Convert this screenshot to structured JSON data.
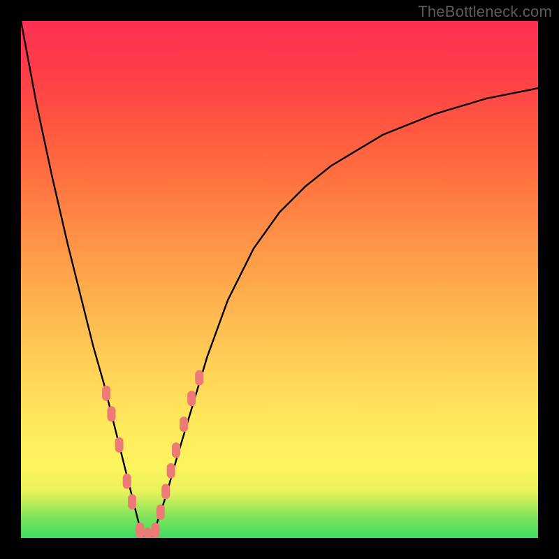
{
  "watermark": "TheBottleneck.com",
  "chart_data": {
    "type": "line",
    "title": "",
    "xlabel": "",
    "ylabel": "",
    "xlim": [
      0,
      100
    ],
    "ylim": [
      0,
      100
    ],
    "grid": false,
    "legend": false,
    "series": [
      {
        "name": "bottleneck-curve",
        "color": "#000000",
        "x": [
          0,
          3,
          6,
          9,
          12,
          14,
          16,
          18,
          19.5,
          21,
          22,
          23,
          24,
          25,
          26,
          28,
          30,
          33,
          36,
          40,
          45,
          50,
          55,
          60,
          65,
          70,
          75,
          80,
          85,
          90,
          95,
          100
        ],
        "y": [
          100,
          84,
          70,
          57,
          45,
          37,
          30,
          22,
          16,
          10,
          6,
          2,
          0,
          0,
          2,
          8,
          15,
          25,
          35,
          46,
          56,
          63,
          68,
          72,
          75,
          78,
          80,
          82,
          83.5,
          85,
          86,
          87
        ]
      }
    ],
    "markers": [
      {
        "name": "gpu-cluster-left",
        "color": "#ee7a76",
        "shape": "rounded-rect",
        "points": [
          {
            "x": 16.5,
            "y": 28
          },
          {
            "x": 17.5,
            "y": 24
          },
          {
            "x": 19.0,
            "y": 18
          },
          {
            "x": 20.5,
            "y": 11
          },
          {
            "x": 21.5,
            "y": 7
          },
          {
            "x": 23.0,
            "y": 1.5
          },
          {
            "x": 24.5,
            "y": 0.5
          }
        ]
      },
      {
        "name": "gpu-cluster-right",
        "color": "#ee7a76",
        "shape": "rounded-rect",
        "points": [
          {
            "x": 26.0,
            "y": 1.5
          },
          {
            "x": 27.0,
            "y": 5
          },
          {
            "x": 28.0,
            "y": 9
          },
          {
            "x": 29.0,
            "y": 13
          },
          {
            "x": 30.0,
            "y": 17
          },
          {
            "x": 31.5,
            "y": 22
          },
          {
            "x": 33.0,
            "y": 27
          },
          {
            "x": 34.5,
            "y": 31
          }
        ]
      }
    ],
    "background_gradient": {
      "direction": "vertical",
      "stops": [
        {
          "pos": 0,
          "color": "#3fdc64"
        },
        {
          "pos": 100,
          "color": "#fb3052"
        }
      ]
    }
  }
}
